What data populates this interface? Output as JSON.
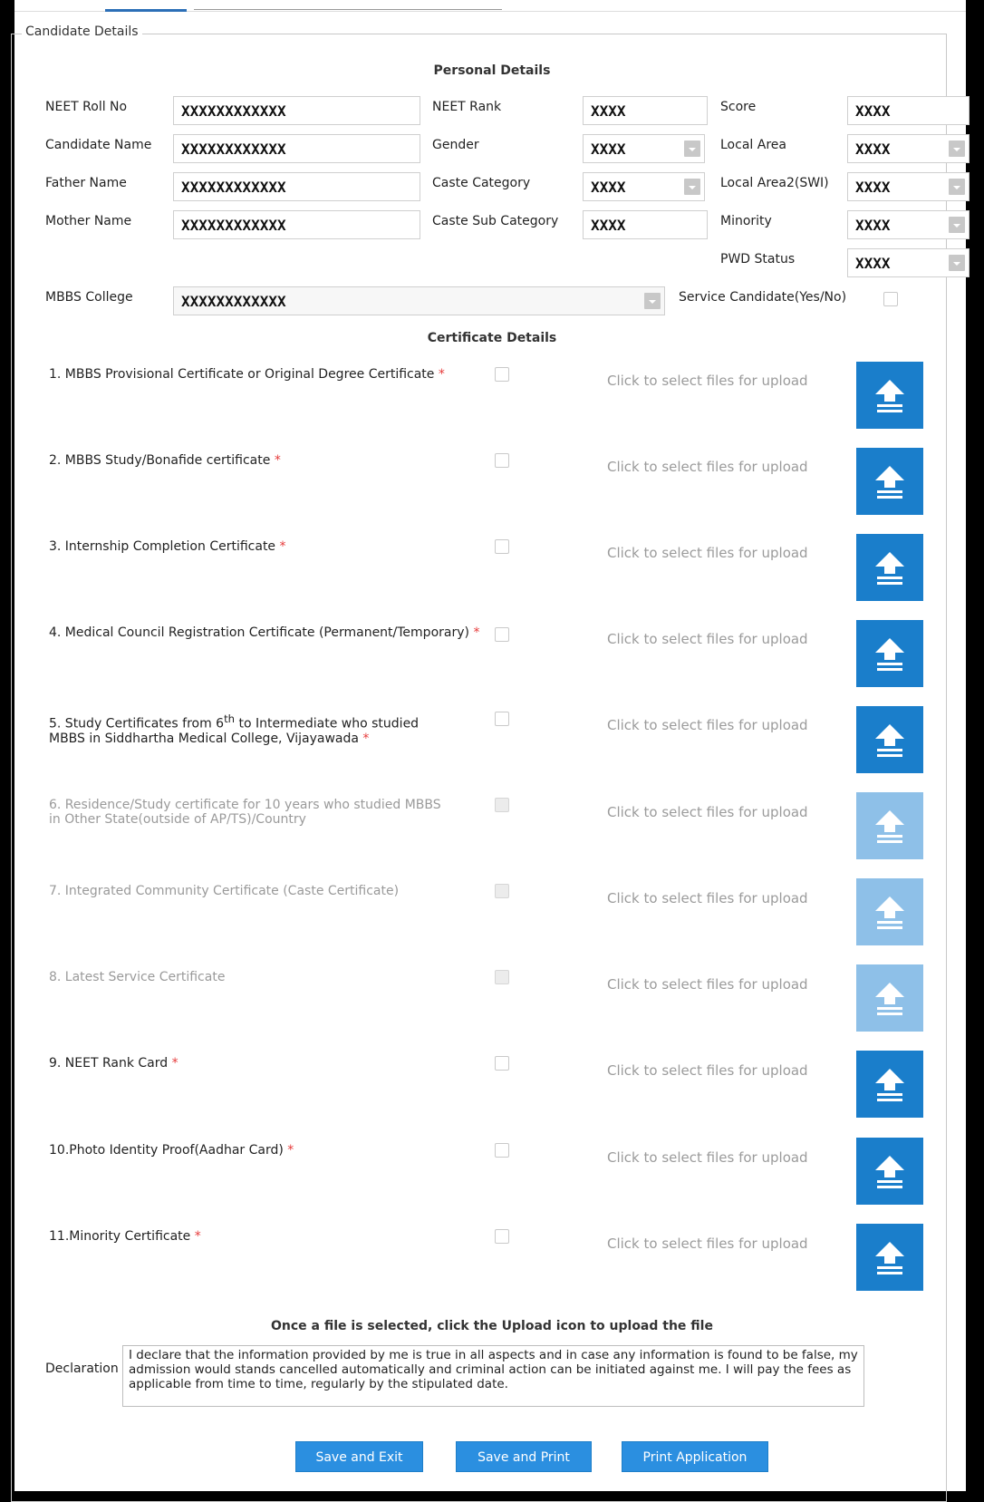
{
  "fieldset_title": "Candidate Details",
  "personal": {
    "title": "Personal Details",
    "neet_roll_no": {
      "label": "NEET Roll No",
      "value": "XXXXXXXXXXXX"
    },
    "candidate_name": {
      "label": "Candidate Name",
      "value": "XXXXXXXXXXXX"
    },
    "father_name": {
      "label": "Father Name",
      "value": "XXXXXXXXXXXX"
    },
    "mother_name": {
      "label": "Mother Name",
      "value": "XXXXXXXXXXXX"
    },
    "neet_rank": {
      "label": "NEET Rank",
      "value": "XXXX"
    },
    "gender": {
      "label": "Gender",
      "value": "XXXX"
    },
    "caste_category": {
      "label": "Caste Category",
      "value": "XXXX"
    },
    "caste_sub_category": {
      "label": "Caste Sub Category",
      "value": "XXXX"
    },
    "score": {
      "label": "Score",
      "value": "XXXX"
    },
    "local_area": {
      "label": "Local Area",
      "value": "XXXX"
    },
    "local_area2": {
      "label": "Local Area2(SWI)",
      "value": "XXXX"
    },
    "minority": {
      "label": "Minority",
      "value": "XXXX"
    },
    "pwd_status": {
      "label": "PWD Status",
      "value": "XXXX"
    },
    "mbbs_college": {
      "label": "MBBS College",
      "value": "XXXXXXXXXXXX"
    },
    "service_candidate": {
      "label": "Service Candidate(Yes/No)"
    }
  },
  "certificates": {
    "title": "Certificate Details",
    "upload_hint": "Click to select files for upload",
    "items": [
      {
        "label": "1. MBBS Provisional Certificate or Original Degree Certificate",
        "required": "*"
      },
      {
        "label": "2. MBBS Study/Bonafide certificate",
        "required": "*"
      },
      {
        "label": "3. Internship Completion Certificate",
        "required": "*"
      },
      {
        "label": "4. Medical Council Registration Certificate (Permanent/Temporary)",
        "required": "*"
      },
      {
        "label_a": "5. Study Certificates from 6",
        "label_sup": "th",
        "label_b": " to Intermediate who studied",
        "label_c": "MBBS in Siddhartha Medical College, Vijayawada",
        "required": "*"
      },
      {
        "label_a": "6. Residence/Study certificate for 10 years who studied MBBS",
        "label_c": "in Other State(outside of AP/TS)/Country"
      },
      {
        "label": "7. Integrated Community Certificate (Caste Certificate)"
      },
      {
        "label": "8. Latest Service Certificate"
      },
      {
        "label": "9. NEET Rank Card",
        "required": "*"
      },
      {
        "label": "10.Photo Identity Proof(Aadhar Card)",
        "required": "*"
      },
      {
        "label": "11.Minority Certificate",
        "required": "*"
      }
    ]
  },
  "notice": "Once a file is selected, click the Upload icon to upload the file",
  "declaration": {
    "label": "Declaration",
    "text": "I declare that the information provided by me is true in all aspects and in case any information is found to be false, my admission would stands cancelled automatically and criminal action can be initiated against me. I will pay the fees as applicable from time to time, regularly by the stipulated date."
  },
  "buttons": {
    "save_exit": "Save and Exit",
    "save_print": "Save and Print",
    "print_app": "Print Application"
  },
  "colors": {
    "upload_active": "#1a7ecb",
    "upload_disabled": "#8ec0e8",
    "button": "#2b8fe0",
    "required": "#e63b3b"
  }
}
